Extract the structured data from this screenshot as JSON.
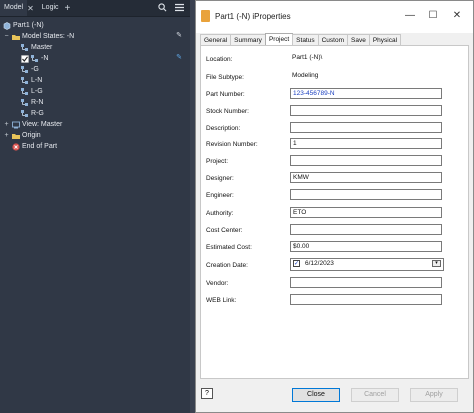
{
  "browser": {
    "tabs": [
      {
        "label": "Model"
      },
      {
        "label": "Logic"
      }
    ],
    "tree": [
      {
        "label": "Part1 (-N)"
      },
      {
        "label": "Model States: -N"
      },
      {
        "label": "Master"
      },
      {
        "label": "-N"
      },
      {
        "label": "-G"
      },
      {
        "label": "L-N"
      },
      {
        "label": "L-G"
      },
      {
        "label": "R-N"
      },
      {
        "label": "R-G"
      },
      {
        "label": "View: Master"
      },
      {
        "label": "Origin"
      },
      {
        "label": "End of Part"
      }
    ]
  },
  "dialog": {
    "title": "Part1 (-N) iProperties",
    "tabs": [
      "General",
      "Summary",
      "Project",
      "Status",
      "Custom",
      "Save",
      "Physical"
    ],
    "active_tab": "Project",
    "fields": [
      {
        "label": "Location:",
        "value": "Part1 (-N)\\"
      },
      {
        "label": "File Subtype:",
        "value": "Modeling"
      },
      {
        "label": "Part Number:",
        "value": "123-456789-N"
      },
      {
        "label": "Stock Number:",
        "value": ""
      },
      {
        "label": "Description:",
        "value": ""
      },
      {
        "label": "Revision Number:",
        "value": "1"
      },
      {
        "label": "Project:",
        "value": ""
      },
      {
        "label": "Designer:",
        "value": "KMW"
      },
      {
        "label": "Engineer:",
        "value": ""
      },
      {
        "label": "Authority:",
        "value": "ETO"
      },
      {
        "label": "Cost Center:",
        "value": ""
      },
      {
        "label": "Estimated Cost:",
        "value": "$0.00"
      },
      {
        "label": "Creation Date:",
        "value": "6/12/2023"
      },
      {
        "label": "Vendor:",
        "value": ""
      },
      {
        "label": "WEB Link:",
        "value": ""
      }
    ],
    "buttons": {
      "close": "Close",
      "cancel": "Cancel",
      "apply": "Apply"
    }
  },
  "colors": {
    "panel_bg": "#303846",
    "accent": "#0078d7",
    "link_blue": "#1a3fbf"
  }
}
